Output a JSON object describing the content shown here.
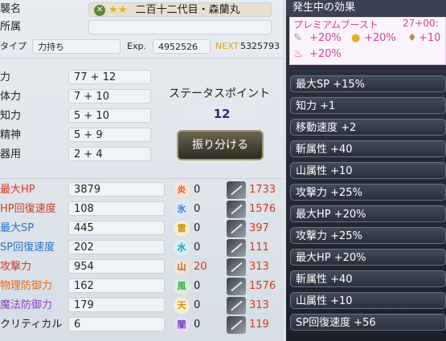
{
  "header": {
    "name_label": "襲名",
    "name_value": "二百十二代目・森蘭丸",
    "affiliation_label": "所属",
    "affiliation_value": "",
    "type_label": "タイプ",
    "type_value": "力持ち",
    "exp_label": "Exp.",
    "exp_value": "4952526",
    "next_label": "NEXT",
    "next_value": "5325793"
  },
  "stats": [
    {
      "label": "力",
      "value": "77 + 12"
    },
    {
      "label": "体力",
      "value": "7 + 10"
    },
    {
      "label": "知力",
      "value": "5 + 10"
    },
    {
      "label": "精神",
      "value": "5 +  9"
    },
    {
      "label": "器用",
      "value": "2 +  4"
    }
  ],
  "status_points": {
    "label": "ステータスポイント",
    "value": "12",
    "button_label": "振り分ける"
  },
  "derived": [
    {
      "label": "最大HP",
      "value": "3879",
      "color": "#d43a1f"
    },
    {
      "label": "HP回復速度",
      "value": "108",
      "color": "#d43a1f"
    },
    {
      "label": "最大SP",
      "value": "445",
      "color": "#2d74c4"
    },
    {
      "label": "SP回復速度",
      "value": "202",
      "color": "#2d74c4"
    },
    {
      "label": "攻撃力",
      "value": "954",
      "color": "#d43a1f"
    },
    {
      "label": "物理防御力",
      "value": "162",
      "color": "#e46a16"
    },
    {
      "label": "魔法防御力",
      "value": "179",
      "color": "#8a3fc5"
    },
    {
      "label": "クリティカル",
      "value": "6",
      "color": "#222222"
    }
  ],
  "elements": [
    {
      "glyph": "炎",
      "value": "0",
      "weapon": "1733",
      "color": "#e8561e"
    },
    {
      "glyph": "氷",
      "value": "0",
      "weapon": "1576",
      "color": "#3a7fd6"
    },
    {
      "glyph": "雷",
      "value": "0",
      "weapon": "397",
      "color": "#e0b21a"
    },
    {
      "glyph": "水",
      "value": "0",
      "weapon": "111",
      "color": "#1d9bb0"
    },
    {
      "glyph": "山",
      "value": "20",
      "weapon": "313",
      "color": "#b0662b"
    },
    {
      "glyph": "風",
      "value": "0",
      "weapon": "1576",
      "color": "#3da84a"
    },
    {
      "glyph": "天",
      "value": "0",
      "weapon": "313",
      "color": "#d9b21f"
    },
    {
      "glyph": "闇",
      "value": "0",
      "weapon": "119",
      "color": "#7a45c0"
    }
  ],
  "effects_panel": {
    "title": "発生中の効果",
    "premium_label": "プレミアムブースト",
    "premium_timer": "27+00:",
    "boosts": [
      "+20%",
      "+20%",
      "+10",
      "+20%"
    ],
    "items": [
      "最大SP +15%",
      "知力 +1",
      "移動速度 +2",
      "斬属性 +40",
      "山属性 +10",
      "攻撃力 +25%",
      "最大HP +20%",
      "攻撃力 +25%",
      "最大HP +20%",
      "斬属性 +40",
      "山属性 +10",
      "SP回復速度 +56"
    ]
  }
}
